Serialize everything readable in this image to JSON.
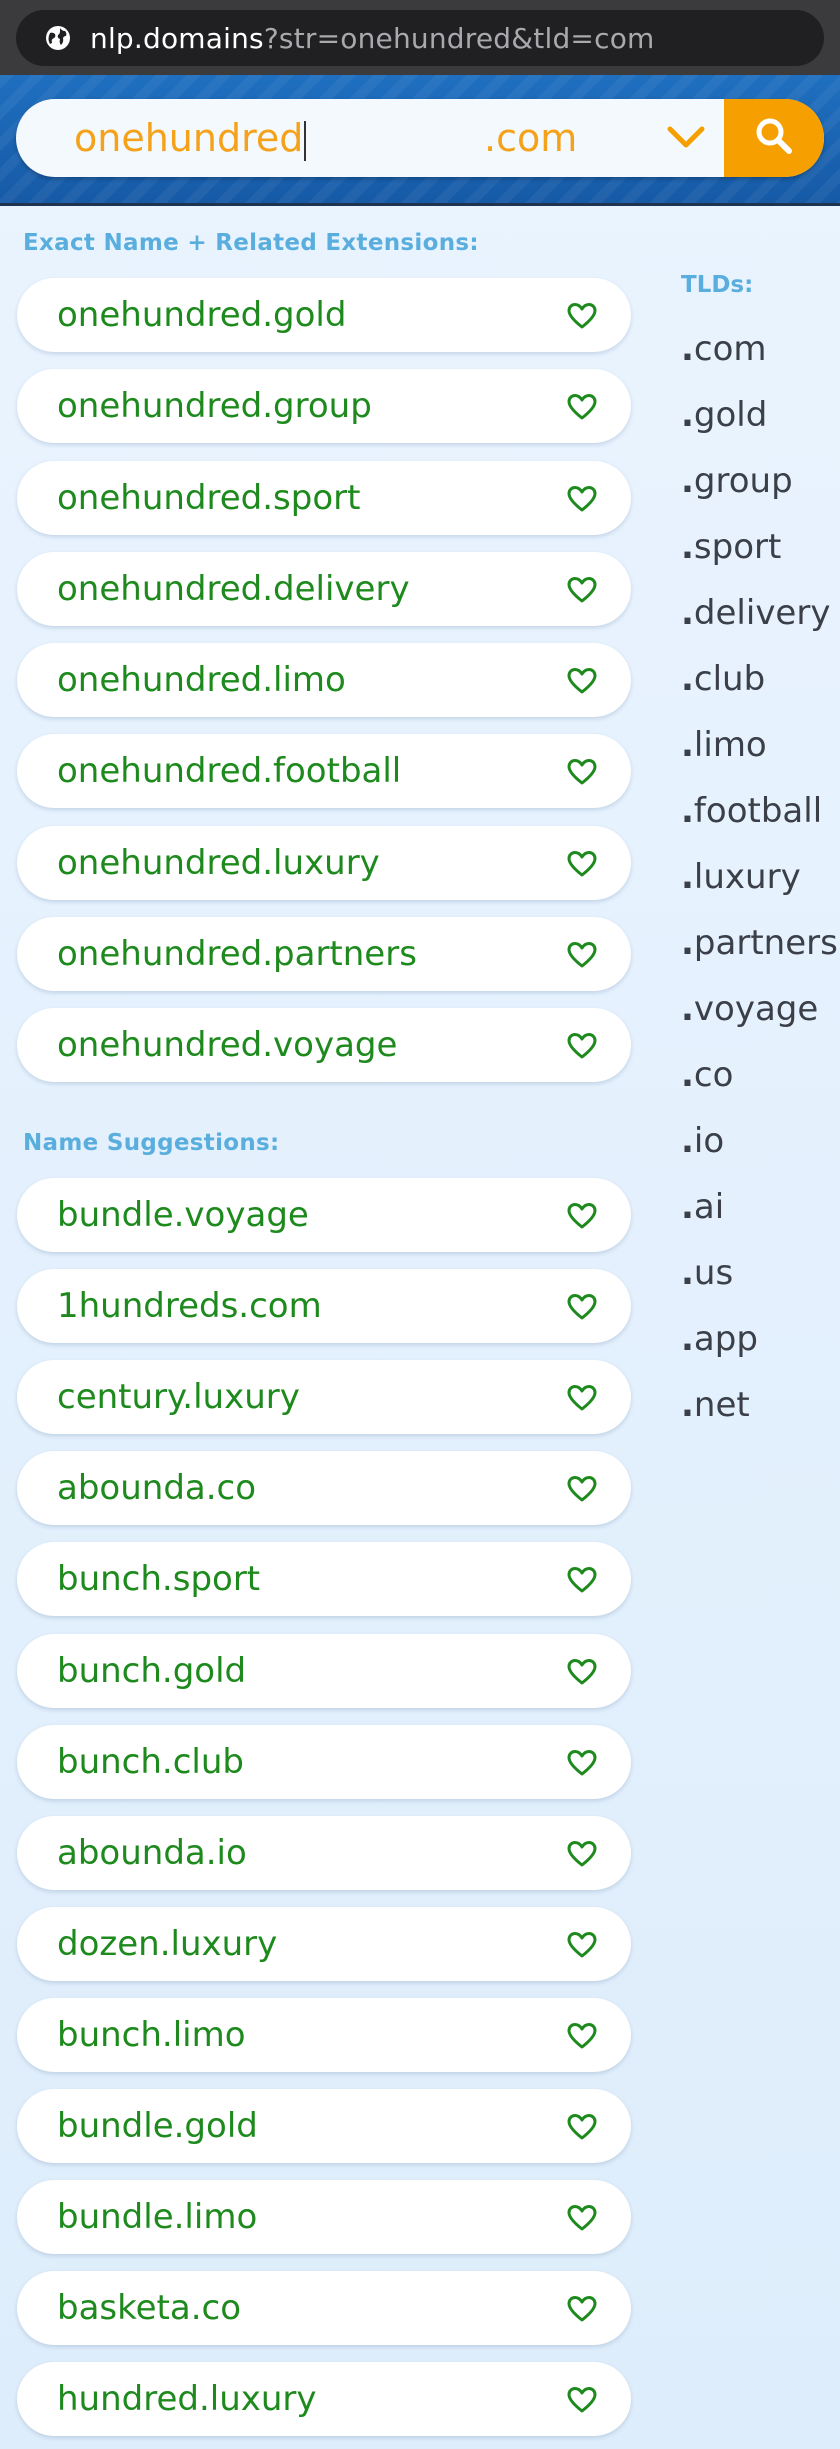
{
  "browser": {
    "url_host": "nlp.domains",
    "url_query": "?str=onehundred&tld=com"
  },
  "search": {
    "query": "onehundred",
    "tld": ".com"
  },
  "exact": {
    "label": "Exact Name + Related Extensions:",
    "items": [
      "onehundred.gold",
      "onehundred.group",
      "onehundred.sport",
      "onehundred.delivery",
      "onehundred.limo",
      "onehundred.football",
      "onehundred.luxury",
      "onehundred.partners",
      "onehundred.voyage"
    ]
  },
  "suggestions": {
    "label": "Name Suggestions:",
    "items": [
      "bundle.voyage",
      "1hundreds.com",
      "century.luxury",
      "abounda.co",
      "bunch.sport",
      "bunch.gold",
      "bunch.club",
      "abounda.io",
      "dozen.luxury",
      "bunch.limo",
      "bundle.gold",
      "bundle.limo",
      "basketa.co",
      "hundred.luxury"
    ]
  },
  "tlds": {
    "label": "TLDs:",
    "items": [
      "com",
      "gold",
      "group",
      "sport",
      "delivery",
      "club",
      "limo",
      "football",
      "luxury",
      "partners",
      "voyage",
      "co",
      "io",
      "ai",
      "us",
      "app",
      "net"
    ]
  },
  "colors": {
    "accent": "#f5a000",
    "domain_text": "#1e8a1e",
    "section_label": "#5aaede",
    "banner": "#1b63b3"
  }
}
